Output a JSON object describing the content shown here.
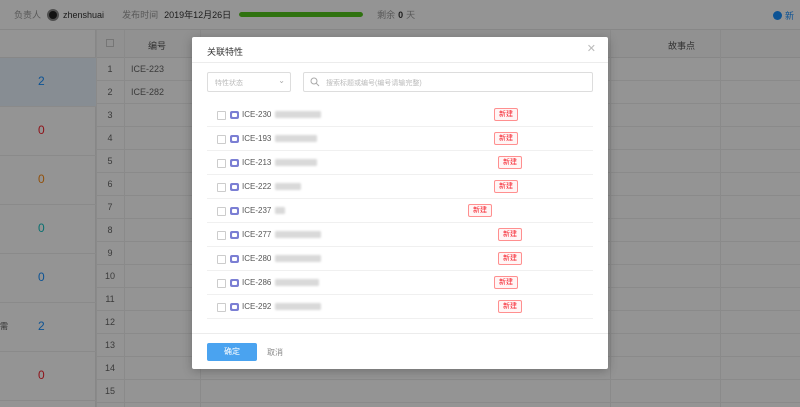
{
  "topbar": {
    "owner_label": "负责人",
    "owner_name": "zhenshuai",
    "release_label": "发布时间",
    "release_date": "2019年12月26日",
    "progress": 1.0,
    "remaining_label": "剩余",
    "remaining_value": "0",
    "remaining_unit": "天",
    "more_label": "新"
  },
  "left_counts": [
    "2",
    "0",
    "0",
    "0",
    "0",
    "2",
    "0"
  ],
  "left_side_labels": [
    "",
    "",
    "",
    "",
    "",
    "需",
    ""
  ],
  "table": {
    "headers": [
      "编号",
      "",
      "",
      "",
      "",
      "",
      "故事点"
    ],
    "rows": [
      {
        "idx": "1",
        "code": "ICE-223"
      },
      {
        "idx": "2",
        "code": "ICE-282"
      },
      {
        "idx": "3",
        "code": ""
      },
      {
        "idx": "4",
        "code": ""
      },
      {
        "idx": "5",
        "code": ""
      },
      {
        "idx": "6",
        "code": ""
      },
      {
        "idx": "7",
        "code": ""
      },
      {
        "idx": "8",
        "code": ""
      },
      {
        "idx": "9",
        "code": ""
      },
      {
        "idx": "10",
        "code": ""
      },
      {
        "idx": "11",
        "code": ""
      },
      {
        "idx": "12",
        "code": ""
      },
      {
        "idx": "13",
        "code": ""
      },
      {
        "idx": "14",
        "code": ""
      },
      {
        "idx": "15",
        "code": ""
      }
    ]
  },
  "modal": {
    "title": "关联特性",
    "close_icon": "close-icon",
    "status_placeholder": "特性状态",
    "search_placeholder": "搜索标题或编号(编号请输完整)",
    "items": [
      {
        "code": "ICE-230",
        "tag": "新建"
      },
      {
        "code": "ICE-193",
        "tag": "新建"
      },
      {
        "code": "ICE-213",
        "tag": "新建"
      },
      {
        "code": "ICE-222",
        "tag": "新建"
      },
      {
        "code": "ICE-237",
        "tag": "新建"
      },
      {
        "code": "ICE-277",
        "tag": "新建"
      },
      {
        "code": "ICE-280",
        "tag": "新建"
      },
      {
        "code": "ICE-286",
        "tag": "新建"
      },
      {
        "code": "ICE-292",
        "tag": "新建"
      }
    ],
    "ok_label": "确定",
    "cancel_label": "取消"
  },
  "colors": {
    "primary": "#4aa3f0",
    "tag_red": "#f5222d",
    "progress_green": "#52c41a",
    "feature_icon": "#7b7fd4"
  }
}
